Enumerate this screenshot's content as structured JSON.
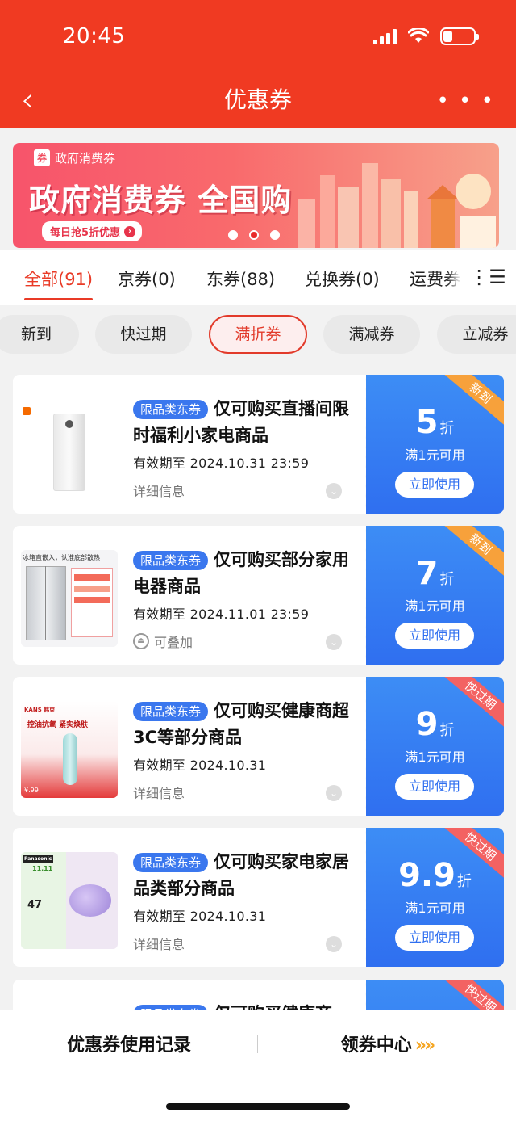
{
  "status": {
    "time": "20:45"
  },
  "header": {
    "back_icon": "chevron-left-icon",
    "title": "优惠券",
    "more_icon": "more-icon",
    "more_text": "• • •"
  },
  "banner": {
    "badge_icon": "券",
    "badge": "政府消费券",
    "title": "政府消费券 全国购",
    "pill": "每日抢5折优惠",
    "colors": {
      "start": "#f7546b",
      "end": "#f7a08a"
    }
  },
  "tabs": [
    "全部(91)",
    "京券(0)",
    "东券(88)",
    "兑换券(0)",
    "运费券"
  ],
  "tab_menu_icon": "⋮☰",
  "chips": [
    "新到",
    "快过期",
    "满折券",
    "满减券",
    "立减券"
  ],
  "coupons": [
    {
      "tag": "限品类东券",
      "title": "仅可购买直播间限时福利小家电商品",
      "validity": "有效期至 2024.10.31 23:59",
      "detail": "详细信息",
      "amount": "5",
      "unit": "折",
      "min": "满1元可用",
      "button": "立即使用",
      "ribbon": "新到",
      "brand": "mi"
    },
    {
      "tag": "限品类东券",
      "title": "仅可购买部分家用电器商品",
      "validity": "有效期至 2024.11.01 23:59",
      "detail": "可叠加",
      "amount": "7",
      "unit": "折",
      "min": "满1元可用",
      "button": "立即使用",
      "ribbon": "新到",
      "thumb_text": "冰箱直嵌入，认准底部散热"
    },
    {
      "tag": "限品类东券",
      "title": "仅可购买健康商超3C等部分商品",
      "validity": "有效期至 2024.10.31",
      "detail": "详细信息",
      "amount": "9",
      "unit": "折",
      "min": "满1元可用",
      "button": "立即使用",
      "ribbon": "快过期",
      "thumb_text": "控油抗氧 紧实焕肤",
      "brand": "KANS 韩束",
      "price": "¥.99"
    },
    {
      "tag": "限品类东券",
      "title": "仅可购买家电家居品类部分商品",
      "validity": "有效期至 2024.10.31",
      "detail": "详细信息",
      "amount": "9.9",
      "unit": "折",
      "min": "满1元可用",
      "button": "立即使用",
      "ribbon": "快过期",
      "brand": "Panasonic",
      "price": "47",
      "promo": "11.11"
    },
    {
      "tag": "限品类东券",
      "title": "仅可购买健康商",
      "ribbon": "快过期"
    }
  ],
  "bottom": {
    "left": "优惠券使用记录",
    "right": "领券中心",
    "arrow": "»»"
  }
}
